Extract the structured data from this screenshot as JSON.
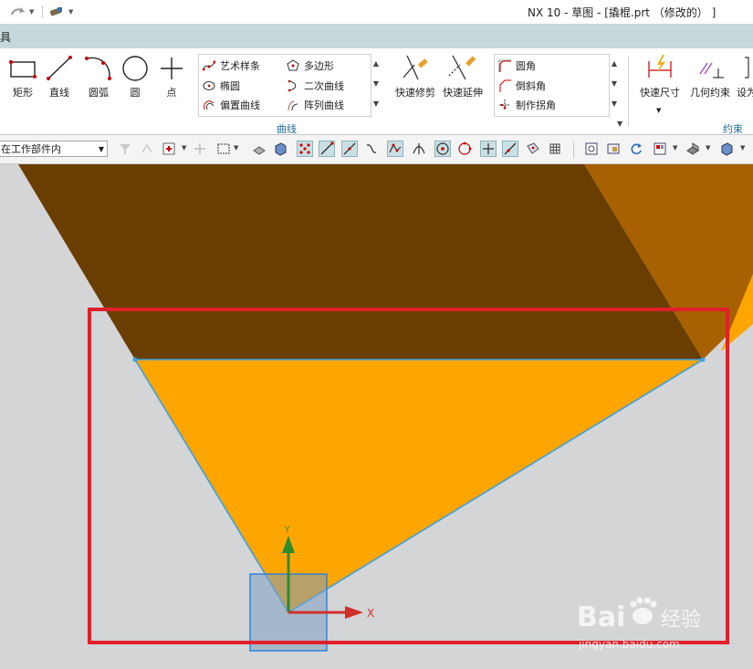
{
  "title_bar": {
    "title": "NX 10 - 草图 - [撬棍.prt （修改的） ]"
  },
  "menu": {
    "partial_label": "具"
  },
  "ribbon": {
    "big_buttons": [
      {
        "label": "矩形",
        "icon": "rectangle-icon"
      },
      {
        "label": "直线",
        "icon": "line-icon"
      },
      {
        "label": "圆弧",
        "icon": "arc-icon"
      },
      {
        "label": "圆",
        "icon": "circle-icon"
      },
      {
        "label": "点",
        "icon": "point-icon"
      }
    ],
    "curve_gallery": [
      {
        "label": "艺术样条",
        "icon": "studio-spline-icon"
      },
      {
        "label": "多边形",
        "icon": "polygon-icon"
      },
      {
        "label": "椭圆",
        "icon": "ellipse-icon"
      },
      {
        "label": "二次曲线",
        "icon": "conic-icon"
      },
      {
        "label": "偏置曲线",
        "icon": "offset-curve-icon"
      },
      {
        "label": "阵列曲线",
        "icon": "pattern-curve-icon"
      }
    ],
    "edit_buttons": [
      {
        "label": "快速修剪",
        "icon": "quick-trim-icon"
      },
      {
        "label": "快速延伸",
        "icon": "quick-extend-icon"
      }
    ],
    "corner_gallery": [
      {
        "label": "圆角",
        "icon": "fillet-icon"
      },
      {
        "label": "倒斜角",
        "icon": "chamfer-icon"
      },
      {
        "label": "制作拐角",
        "icon": "make-corner-icon"
      }
    ],
    "curve_group_label": "曲线",
    "constraint_buttons": [
      {
        "label": "快速尺寸",
        "icon": "rapid-dimension-icon"
      },
      {
        "label": "几何约束",
        "icon": "geometric-constraint-icon"
      },
      {
        "label": "设为",
        "icon": "set-as-symmetric-icon"
      }
    ],
    "constraint_group_label": "约束"
  },
  "toolbar2": {
    "filter_value": "在工作部件内"
  },
  "canvas": {
    "axis_x_label": "X",
    "axis_y_label": "Y",
    "colors": {
      "background": "#d4d5d7",
      "dark_face": "#6a3e00",
      "light_face": "#ffa500",
      "side_face": "#a86100",
      "sketch_line": "#3aa0e0",
      "highlight_box": "#e0202a",
      "x_axis": "#d0302c",
      "y_axis": "#2e8b2e"
    }
  },
  "watermark": {
    "brand": "Bai",
    "brand_suffix": "经验",
    "url": "jingyan.baidu.com"
  }
}
